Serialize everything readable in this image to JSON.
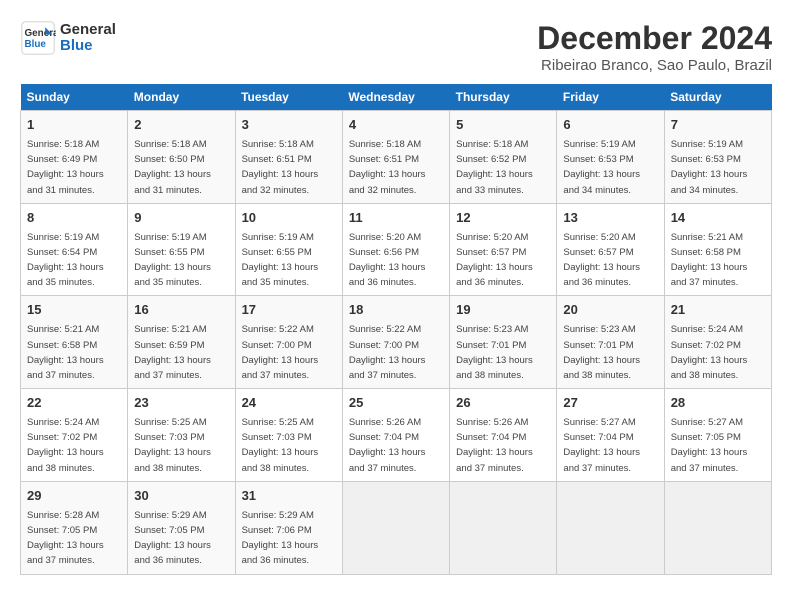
{
  "logo": {
    "line1": "General",
    "line2": "Blue"
  },
  "title": "December 2024",
  "location": "Ribeirao Branco, Sao Paulo, Brazil",
  "days_of_week": [
    "Sunday",
    "Monday",
    "Tuesday",
    "Wednesday",
    "Thursday",
    "Friday",
    "Saturday"
  ],
  "weeks": [
    [
      {
        "day": "1",
        "sunrise": "5:18 AM",
        "sunset": "6:49 PM",
        "daylight": "13 hours and 31 minutes."
      },
      {
        "day": "2",
        "sunrise": "5:18 AM",
        "sunset": "6:50 PM",
        "daylight": "13 hours and 31 minutes."
      },
      {
        "day": "3",
        "sunrise": "5:18 AM",
        "sunset": "6:51 PM",
        "daylight": "13 hours and 32 minutes."
      },
      {
        "day": "4",
        "sunrise": "5:18 AM",
        "sunset": "6:51 PM",
        "daylight": "13 hours and 32 minutes."
      },
      {
        "day": "5",
        "sunrise": "5:18 AM",
        "sunset": "6:52 PM",
        "daylight": "13 hours and 33 minutes."
      },
      {
        "day": "6",
        "sunrise": "5:19 AM",
        "sunset": "6:53 PM",
        "daylight": "13 hours and 34 minutes."
      },
      {
        "day": "7",
        "sunrise": "5:19 AM",
        "sunset": "6:53 PM",
        "daylight": "13 hours and 34 minutes."
      }
    ],
    [
      {
        "day": "8",
        "sunrise": "5:19 AM",
        "sunset": "6:54 PM",
        "daylight": "13 hours and 35 minutes."
      },
      {
        "day": "9",
        "sunrise": "5:19 AM",
        "sunset": "6:55 PM",
        "daylight": "13 hours and 35 minutes."
      },
      {
        "day": "10",
        "sunrise": "5:19 AM",
        "sunset": "6:55 PM",
        "daylight": "13 hours and 35 minutes."
      },
      {
        "day": "11",
        "sunrise": "5:20 AM",
        "sunset": "6:56 PM",
        "daylight": "13 hours and 36 minutes."
      },
      {
        "day": "12",
        "sunrise": "5:20 AM",
        "sunset": "6:57 PM",
        "daylight": "13 hours and 36 minutes."
      },
      {
        "day": "13",
        "sunrise": "5:20 AM",
        "sunset": "6:57 PM",
        "daylight": "13 hours and 36 minutes."
      },
      {
        "day": "14",
        "sunrise": "5:21 AM",
        "sunset": "6:58 PM",
        "daylight": "13 hours and 37 minutes."
      }
    ],
    [
      {
        "day": "15",
        "sunrise": "5:21 AM",
        "sunset": "6:58 PM",
        "daylight": "13 hours and 37 minutes."
      },
      {
        "day": "16",
        "sunrise": "5:21 AM",
        "sunset": "6:59 PM",
        "daylight": "13 hours and 37 minutes."
      },
      {
        "day": "17",
        "sunrise": "5:22 AM",
        "sunset": "7:00 PM",
        "daylight": "13 hours and 37 minutes."
      },
      {
        "day": "18",
        "sunrise": "5:22 AM",
        "sunset": "7:00 PM",
        "daylight": "13 hours and 37 minutes."
      },
      {
        "day": "19",
        "sunrise": "5:23 AM",
        "sunset": "7:01 PM",
        "daylight": "13 hours and 38 minutes."
      },
      {
        "day": "20",
        "sunrise": "5:23 AM",
        "sunset": "7:01 PM",
        "daylight": "13 hours and 38 minutes."
      },
      {
        "day": "21",
        "sunrise": "5:24 AM",
        "sunset": "7:02 PM",
        "daylight": "13 hours and 38 minutes."
      }
    ],
    [
      {
        "day": "22",
        "sunrise": "5:24 AM",
        "sunset": "7:02 PM",
        "daylight": "13 hours and 38 minutes."
      },
      {
        "day": "23",
        "sunrise": "5:25 AM",
        "sunset": "7:03 PM",
        "daylight": "13 hours and 38 minutes."
      },
      {
        "day": "24",
        "sunrise": "5:25 AM",
        "sunset": "7:03 PM",
        "daylight": "13 hours and 38 minutes."
      },
      {
        "day": "25",
        "sunrise": "5:26 AM",
        "sunset": "7:04 PM",
        "daylight": "13 hours and 37 minutes."
      },
      {
        "day": "26",
        "sunrise": "5:26 AM",
        "sunset": "7:04 PM",
        "daylight": "13 hours and 37 minutes."
      },
      {
        "day": "27",
        "sunrise": "5:27 AM",
        "sunset": "7:04 PM",
        "daylight": "13 hours and 37 minutes."
      },
      {
        "day": "28",
        "sunrise": "5:27 AM",
        "sunset": "7:05 PM",
        "daylight": "13 hours and 37 minutes."
      }
    ],
    [
      {
        "day": "29",
        "sunrise": "5:28 AM",
        "sunset": "7:05 PM",
        "daylight": "13 hours and 37 minutes."
      },
      {
        "day": "30",
        "sunrise": "5:29 AM",
        "sunset": "7:05 PM",
        "daylight": "13 hours and 36 minutes."
      },
      {
        "day": "31",
        "sunrise": "5:29 AM",
        "sunset": "7:06 PM",
        "daylight": "13 hours and 36 minutes."
      },
      null,
      null,
      null,
      null
    ]
  ]
}
